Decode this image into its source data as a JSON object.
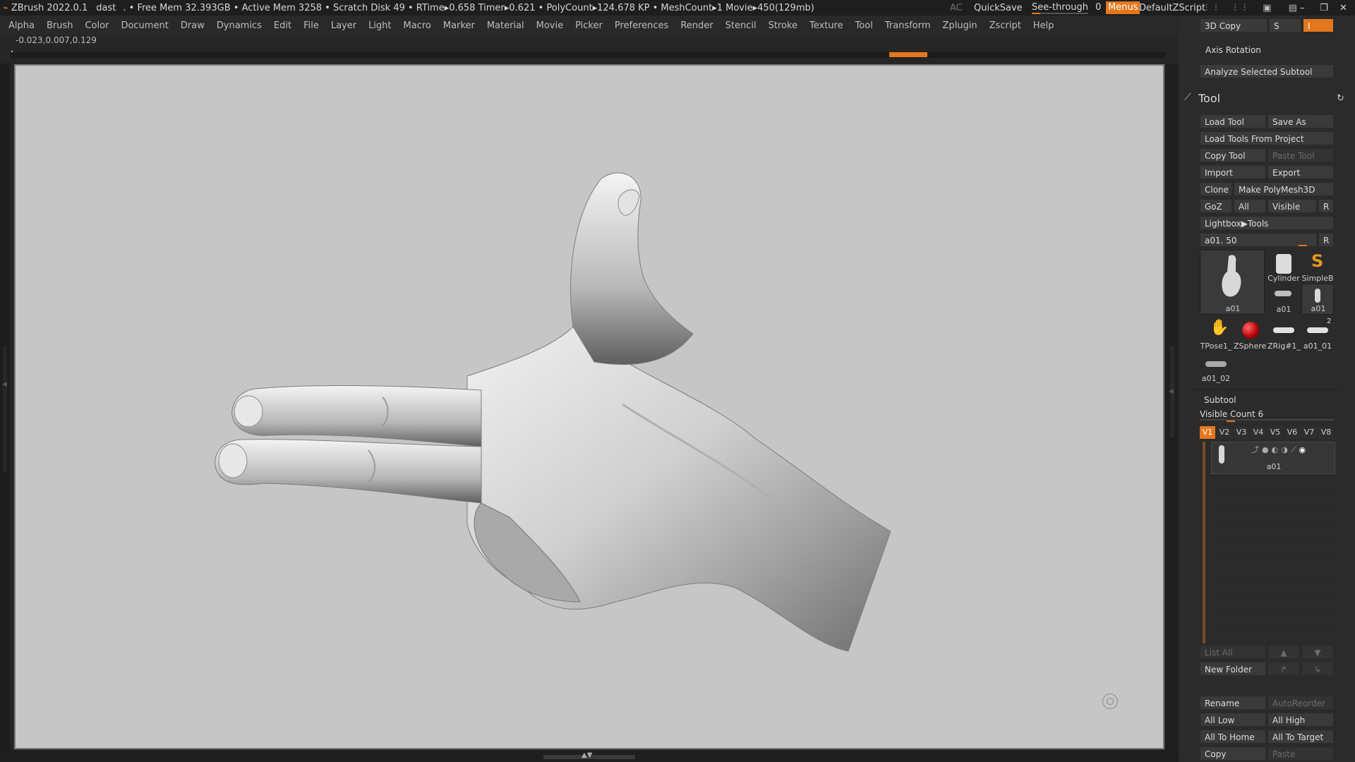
{
  "titlebar": {
    "app": "ZBrush 2022.0.1",
    "doc": "dast",
    "status": ". • Free Mem 32.393GB • Active Mem 3258 • Scratch Disk 49 • RTime▸0.658 Timer▸0.621 • PolyCount▸124.678 KP • MeshCount▸1 Movie▸450(129mb)",
    "ac": "AC",
    "quicksave": "QuickSave",
    "see_through": "See-through",
    "see_through_value": "0",
    "menus": "Menus",
    "zscript": "DefaultZScript"
  },
  "menus": [
    "Alpha",
    "Brush",
    "Color",
    "Document",
    "Draw",
    "Dynamics",
    "Edit",
    "File",
    "Layer",
    "Light",
    "Macro",
    "Marker",
    "Material",
    "Movie",
    "Picker",
    "Preferences",
    "Render",
    "Stencil",
    "Stroke",
    "Texture",
    "Tool",
    "Transform",
    "Zplugin",
    "Zscript",
    "Help"
  ],
  "coords": "-0.023,0.007,0.129",
  "colors": {
    "accent": "#e4771e",
    "viewport_bg": "#c6c6c6",
    "panel_bg": "#2b2b2b"
  },
  "panel": {
    "copy3d": "3D Copy",
    "s": "S",
    "i": "I",
    "axis_rotation": "Axis Rotation",
    "analyze": "Analyze Selected Subtool",
    "tool_title": "Tool",
    "load_tool": "Load Tool",
    "save_as": "Save As",
    "load_from_project": "Load Tools From Project",
    "copy_tool": "Copy Tool",
    "paste_tool": "Paste Tool",
    "import": "Import",
    "export": "Export",
    "clone": "Clone",
    "make_polymesh": "Make PolyMesh3D",
    "goz": "GoZ",
    "all": "All",
    "visible": "Visible",
    "r": "R",
    "lightbox_tools": "Lightbox▶Tools",
    "tool_slider_label": "a01. 50",
    "tool_slider_r": "R",
    "thumbs": {
      "main": "a01",
      "cylinder": "Cylinder",
      "simpleb": "SimpleB",
      "a01_small": "a01",
      "a01_small2": "a01",
      "tpose": "TPose1_",
      "zsphere": "ZSphere",
      "zrig": "ZRig#1_",
      "a01_01": "a01_01",
      "a01_01_count": "2",
      "a01_02": "a01_02"
    },
    "subtool": "Subtool",
    "visible_count": "Visible Count 6",
    "v_tabs": [
      "V1",
      "V2",
      "V3",
      "V4",
      "V5",
      "V6",
      "V7",
      "V8"
    ],
    "subtool_item": "a01",
    "list_all": "List All",
    "new_folder": "New Folder",
    "rename": "Rename",
    "autoreorder": "AutoReorder",
    "all_low": "All Low",
    "all_high": "All High",
    "all_to_home": "All To Home",
    "all_to_target": "All To Target",
    "copy": "Copy",
    "paste": "Paste"
  }
}
